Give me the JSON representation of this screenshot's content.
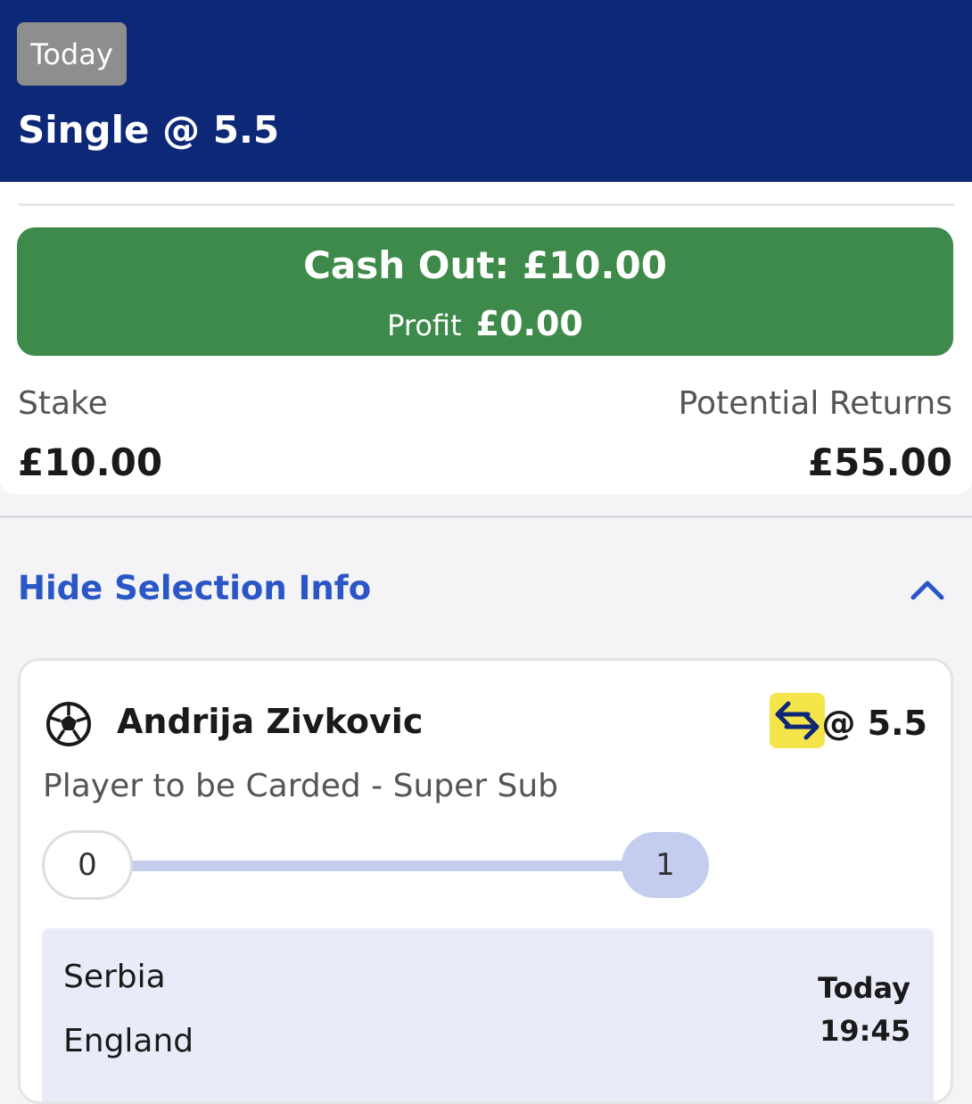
{
  "header": {
    "date_badge": "Today",
    "bet_title": "Single @ 5.5"
  },
  "cashout": {
    "label": "Cash Out: £10.00",
    "profit_label": "Profit",
    "profit_value": "£0.00"
  },
  "summary": {
    "stake_label": "Stake",
    "stake_value": "£10.00",
    "returns_label": "Potential Returns",
    "returns_value": "£55.00"
  },
  "selection_toggle": {
    "label": "Hide Selection Info",
    "icon": "chevron-up-icon"
  },
  "selection": {
    "sport_icon": "football-icon",
    "name": "Andrija Zivkovic",
    "supersub_icon": "swap-arrows-icon",
    "odds": "@ 5.5",
    "market": "Player to be Carded - Super Sub",
    "progress": {
      "start": "0",
      "end": "1",
      "fraction_complete": 1.0
    },
    "event": {
      "home_team": "Serbia",
      "away_team": "England",
      "date": "Today",
      "time": "19:45"
    }
  },
  "colors": {
    "header_bg": "#0e2878",
    "cashout_green": "#3e8a4a",
    "link_blue": "#2a56c6",
    "supersub_yellow": "#f5e54a",
    "progress_fill": "#c5cdef",
    "event_bg": "#e9ecf8"
  }
}
